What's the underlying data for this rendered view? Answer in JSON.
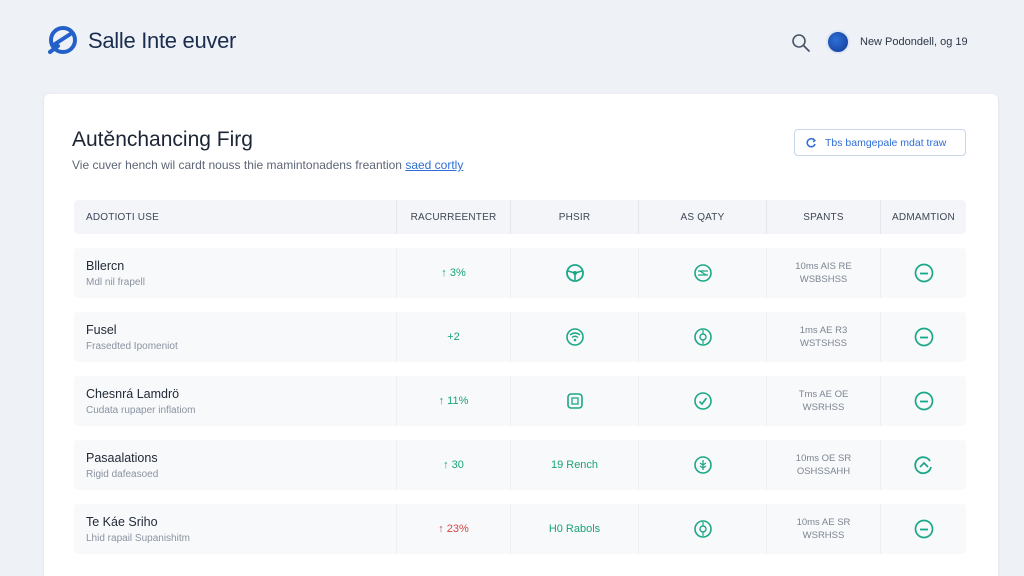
{
  "app": {
    "title": "Salle Inte euver",
    "user_label": "New Podondell, og 19"
  },
  "page": {
    "title": "Autěnchancing Firg",
    "subtitle": "Vie cuver hench wil cardt nouss thie mamintonadens freantion",
    "subtitle_link": "saed cortly",
    "action_label": "Tbs bamgepale mdat traw"
  },
  "table": {
    "headers": [
      "ADOTIOTI USE",
      "RACURREENTER",
      "PHSIR",
      "AS QATY",
      "SPANTS",
      "ADMAMTION"
    ],
    "rows": [
      {
        "name": "Bllercn",
        "desc": "Mdl nil frapell",
        "delta": "↑ 3%",
        "delta_color": "#1aa37a",
        "plan": "",
        "plan_icon": "steering-icon",
        "quality_icon": "globe-icon",
        "status_line1": "10ms AIS RE",
        "status_line2": "WSBSHSS",
        "action_icon": "minus-circle-icon"
      },
      {
        "name": "Fusel",
        "desc": "Frasedted Ipomeniot",
        "delta": "+2",
        "delta_color": "#1aa37a",
        "plan": "",
        "plan_icon": "wifi-icon",
        "quality_icon": "target-icon",
        "status_line1": "1ms AE R3",
        "status_line2": "WSTSHSS",
        "action_icon": "minus-circle-icon"
      },
      {
        "name": "Chesnrá Lamdrö",
        "desc": "Cudata rupaper inflatiom",
        "delta": "↑ 11%",
        "delta_color": "#1aa37a",
        "plan": "",
        "plan_icon": "grid-icon",
        "quality_icon": "check-circle-icon",
        "status_line1": "Tms AE OE",
        "status_line2": "WSRHSS",
        "action_icon": "minus-circle-icon"
      },
      {
        "name": "Pasaalations",
        "desc": "Rigid dafeasoed",
        "delta": "↑ 30",
        "delta_color": "#1aa37a",
        "plan": "19 Rench",
        "plan_icon": "",
        "quality_icon": "wheat-icon",
        "status_line1": "10ms OE SR",
        "status_line2": "OSHSSAHH",
        "action_icon": "arrow-circle-icon"
      },
      {
        "name": "Te Káe Sriho",
        "desc": "Lhid rapail Supanishitm",
        "delta": "↑ 23%",
        "delta_color": "#d24848",
        "plan": "H0 Rabols",
        "plan_icon": "",
        "quality_icon": "target-icon",
        "status_line1": "10ms AE SR",
        "status_line2": "WSRHSS",
        "action_icon": "minus-circle-icon"
      }
    ]
  },
  "colors": {
    "accent": "#2f6fd6",
    "positive": "#1aa37a",
    "negative": "#d24848",
    "icon_teal": "#1ca789"
  }
}
